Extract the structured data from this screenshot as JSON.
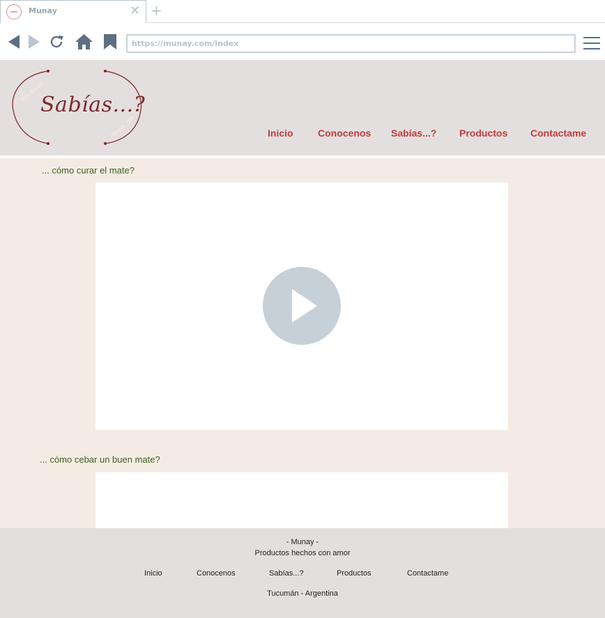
{
  "browser": {
    "tab_title": "Munay",
    "tab_close": "✕",
    "new_tab": "+",
    "url": "https://munay.com/index"
  },
  "site": {
    "logo_text": "Sabías...?",
    "nav": [
      "Inicio",
      "Conocenos",
      "Sabías...?",
      "Productos",
      "Contactame"
    ]
  },
  "main": {
    "sections": [
      {
        "question": "... cómo curar el mate?"
      },
      {
        "question": "... cómo cebar un buen mate?"
      }
    ]
  },
  "footer": {
    "brand": "- Munay -",
    "tagline": "Productos hechos con amor",
    "links": [
      "Inicio",
      "Conocenos",
      "Sabías...?",
      "Productos",
      "Contactame"
    ],
    "location": "Tucumán - Argentina"
  },
  "colors": {
    "nav_link": "#c23b3b",
    "question_text": "#3f5e1f",
    "header_bg": "#e4dfdf",
    "main_bg": "#f4ece4"
  }
}
